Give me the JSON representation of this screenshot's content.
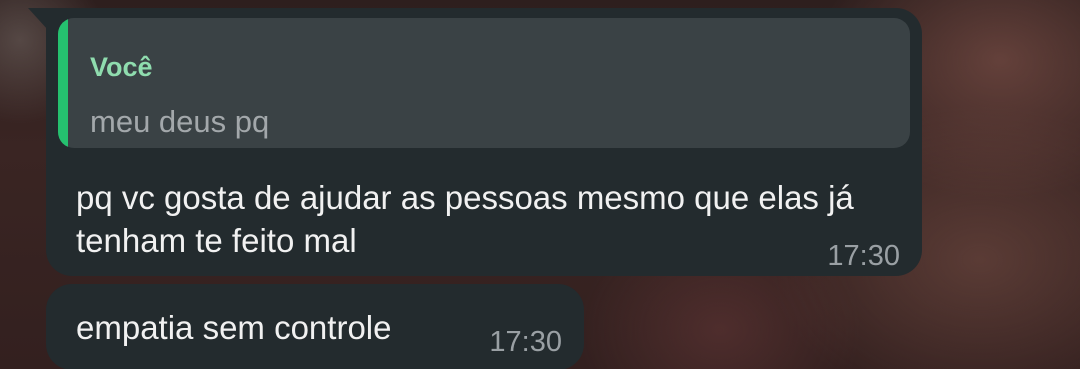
{
  "messages": [
    {
      "reply": {
        "author": "Você",
        "text": "meu deus pq"
      },
      "text": "pq vc gosta de ajudar as pessoas mesmo que elas já tenham te feito mal",
      "time": "17:30"
    },
    {
      "text": "empatia sem controle",
      "time": "17:30"
    }
  ],
  "colors": {
    "bubble": "#232b2e",
    "quote_background": "#3a4245",
    "quote_bar": "#25c16f",
    "quote_author": "#8fdcae"
  }
}
